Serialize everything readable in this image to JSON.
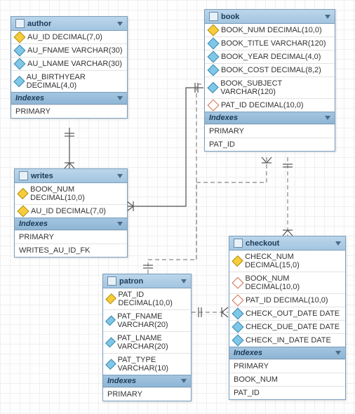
{
  "tables": {
    "author": {
      "title": "author",
      "columns": [
        {
          "icon": "pk",
          "text": "AU_ID DECIMAL(7,0)"
        },
        {
          "icon": "fld",
          "text": "AU_FNAME VARCHAR(30)"
        },
        {
          "icon": "fld",
          "text": "AU_LNAME VARCHAR(30)"
        },
        {
          "icon": "fld",
          "text": "AU_BIRTHYEAR DECIMAL(4,0)"
        }
      ],
      "indexes_label": "Indexes",
      "indexes": [
        "PRIMARY"
      ]
    },
    "book": {
      "title": "book",
      "columns": [
        {
          "icon": "pk",
          "text": "BOOK_NUM DECIMAL(10,0)"
        },
        {
          "icon": "fld",
          "text": "BOOK_TITLE VARCHAR(120)"
        },
        {
          "icon": "fld",
          "text": "BOOK_YEAR DECIMAL(4,0)"
        },
        {
          "icon": "fld",
          "text": "BOOK_COST DECIMAL(8,2)"
        },
        {
          "icon": "fld",
          "text": "BOOK_SUBJECT VARCHAR(120)"
        },
        {
          "icon": "fk",
          "text": "PAT_ID DECIMAL(10,0)"
        }
      ],
      "indexes_label": "Indexes",
      "indexes": [
        "PRIMARY",
        "PAT_ID"
      ]
    },
    "writes": {
      "title": "writes",
      "columns": [
        {
          "icon": "pk",
          "text": "BOOK_NUM DECIMAL(10,0)"
        },
        {
          "icon": "pk",
          "text": "AU_ID DECIMAL(7,0)"
        }
      ],
      "indexes_label": "Indexes",
      "indexes": [
        "PRIMARY",
        "WRITES_AU_ID_FK"
      ]
    },
    "patron": {
      "title": "patron",
      "columns": [
        {
          "icon": "pk",
          "text": "PAT_ID DECIMAL(10,0)"
        },
        {
          "icon": "fld",
          "text": "PAT_FNAME VARCHAR(20)"
        },
        {
          "icon": "fld",
          "text": "PAT_LNAME VARCHAR(20)"
        },
        {
          "icon": "fld",
          "text": "PAT_TYPE VARCHAR(10)"
        }
      ],
      "indexes_label": "Indexes",
      "indexes": [
        "PRIMARY"
      ]
    },
    "checkout": {
      "title": "checkout",
      "columns": [
        {
          "icon": "pk",
          "text": "CHECK_NUM DECIMAL(15,0)"
        },
        {
          "icon": "fk",
          "text": "BOOK_NUM DECIMAL(10,0)"
        },
        {
          "icon": "fk",
          "text": "PAT_ID DECIMAL(10,0)"
        },
        {
          "icon": "fld",
          "text": "CHECK_OUT_DATE DATE"
        },
        {
          "icon": "fld",
          "text": "CHECK_DUE_DATE DATE"
        },
        {
          "icon": "fld",
          "text": "CHECK_IN_DATE DATE"
        }
      ],
      "indexes_label": "Indexes",
      "indexes": [
        "PRIMARY",
        "BOOK_NUM",
        "PAT_ID"
      ]
    }
  },
  "relationships": [
    {
      "from": "author",
      "to": "writes",
      "type": "identifying"
    },
    {
      "from": "book",
      "to": "writes",
      "type": "identifying"
    },
    {
      "from": "patron",
      "to": "book",
      "type": "non-identifying"
    },
    {
      "from": "patron",
      "to": "checkout",
      "type": "non-identifying"
    },
    {
      "from": "book",
      "to": "checkout",
      "type": "non-identifying"
    }
  ]
}
